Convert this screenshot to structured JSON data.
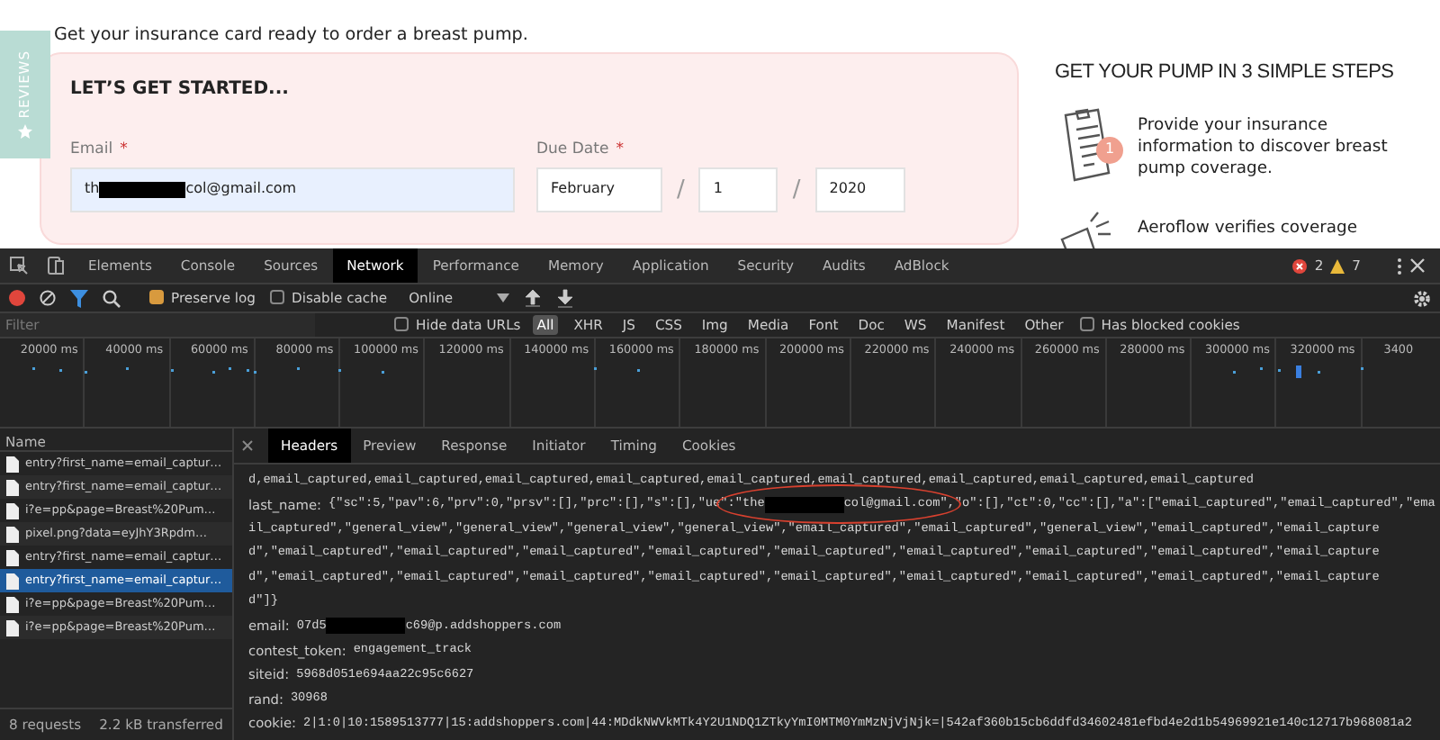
{
  "site": {
    "reviews_tab": "REVIEWS",
    "intro": "Get your insurance card ready to order a breast pump.",
    "form": {
      "title": "LET’S GET STARTED...",
      "email": {
        "label": "Email",
        "required_mark": "*",
        "segments": [
          {
            "kind": "text",
            "text": "th"
          },
          {
            "kind": "redaction"
          },
          {
            "kind": "text",
            "text": "col@gmail.com"
          }
        ]
      },
      "due_date": {
        "label": "Due Date",
        "required_mark": "*",
        "month": "February",
        "day": "1",
        "year": "2020",
        "separators": [
          "/",
          "/"
        ]
      }
    },
    "steps": {
      "title": "GET YOUR PUMP IN 3 SIMPLE STEPS",
      "items": [
        {
          "kind": "clipboard",
          "badge": "1",
          "text": "Provide your insurance information to discover breast pump coverage."
        },
        {
          "kind": "megaphone",
          "text": "Aeroflow verifies coverage"
        }
      ]
    }
  },
  "devtools": {
    "tabs": [
      {
        "label": "Elements",
        "selected": false
      },
      {
        "label": "Console",
        "selected": false
      },
      {
        "label": "Sources",
        "selected": false
      },
      {
        "label": "Network",
        "selected": true
      },
      {
        "label": "Performance",
        "selected": false
      },
      {
        "label": "Memory",
        "selected": false
      },
      {
        "label": "Application",
        "selected": false
      },
      {
        "label": "Security",
        "selected": false
      },
      {
        "label": "Audits",
        "selected": false
      },
      {
        "label": "AdBlock",
        "selected": false
      }
    ],
    "errors": "2",
    "warnings": "7",
    "toolbar": {
      "filter_active": true,
      "preserve_log": {
        "label": "Preserve log",
        "checked": true
      },
      "disable_cache": {
        "label": "Disable cache",
        "checked": false
      },
      "throttling": "Online"
    },
    "filter_bar": {
      "placeholder": "Filter",
      "hide_data_urls": {
        "label": "Hide data URLs",
        "checked": false
      },
      "types": [
        {
          "label": "All",
          "selected": true
        },
        {
          "label": "XHR",
          "selected": false
        },
        {
          "label": "JS",
          "selected": false
        },
        {
          "label": "CSS",
          "selected": false
        },
        {
          "label": "Img",
          "selected": false
        },
        {
          "label": "Media",
          "selected": false
        },
        {
          "label": "Font",
          "selected": false
        },
        {
          "label": "Doc",
          "selected": false
        },
        {
          "label": "WS",
          "selected": false
        },
        {
          "label": "Manifest",
          "selected": false
        },
        {
          "label": "Other",
          "selected": false
        }
      ],
      "has_blocked_cookies": {
        "label": "Has blocked cookies",
        "checked": false
      }
    },
    "timeline": {
      "ticks": [
        "20000 ms",
        "40000 ms",
        "60000 ms",
        "80000 ms",
        "100000 ms",
        "120000 ms",
        "140000 ms",
        "160000 ms",
        "180000 ms",
        "200000 ms",
        "220000 ms",
        "240000 ms",
        "260000 ms",
        "280000 ms",
        "300000 ms",
        "320000 ms",
        "3400"
      ]
    },
    "requests": {
      "header": "Name",
      "items": [
        {
          "name": "entry?first_name=email_captur…",
          "selected": false
        },
        {
          "name": "entry?first_name=email_captur…",
          "selected": false
        },
        {
          "name": "i?e=pp&page=Breast%20Pum…",
          "selected": false
        },
        {
          "name": "pixel.png?data=eyJhY3Rpdm…",
          "selected": false
        },
        {
          "name": "entry?first_name=email_captur…",
          "selected": false
        },
        {
          "name": "entry?first_name=email_captur…",
          "selected": true
        },
        {
          "name": "i?e=pp&page=Breast%20Pum…",
          "selected": false
        },
        {
          "name": "i?e=pp&page=Breast%20Pum…",
          "selected": false
        }
      ],
      "summary": [
        "8 requests",
        "2.2 kB transferred"
      ]
    },
    "details": {
      "tabs": [
        {
          "label": "Headers",
          "selected": true
        },
        {
          "label": "Preview",
          "selected": false
        },
        {
          "label": "Response",
          "selected": false
        },
        {
          "label": "Initiator",
          "selected": false
        },
        {
          "label": "Timing",
          "selected": false
        },
        {
          "label": "Cookies",
          "selected": false
        }
      ],
      "lines": [
        {
          "segments": [
            {
              "kind": "text",
              "text": "d,email_captured,email_captured,email_captured,email_captured,email_captured,email_captured,email_captured,email_captured,email_captured"
            }
          ]
        },
        {
          "key": "last_name:",
          "segments": [
            {
              "kind": "text",
              "text": "{\"sc\":5,\"pav\":6,\"prv\":0,\"prsv\":[],\"prc\":[],\"s\":[],\"ue\":"
            },
            {
              "kind": "circle",
              "segments": [
                {
                  "kind": "text",
                  "text": "\"the"
                },
                {
                  "kind": "redaction"
                },
                {
                  "kind": "text",
                  "text": "col@gmail.com\""
                }
              ]
            },
            {
              "kind": "text",
              "text": ",\"o\":[],\"ct\":0,\"cc\":[],\"a\":[\"email_captured\",\"email_captured\",\"ema"
            }
          ]
        },
        {
          "segments": [
            {
              "kind": "text",
              "text": "il_captured\",\"general_view\",\"general_view\",\"general_view\",\"general_view\",\"email_captured\",\"email_captured\",\"general_view\",\"email_captured\",\"email_capture"
            }
          ]
        },
        {
          "segments": [
            {
              "kind": "text",
              "text": "d\",\"email_captured\",\"email_captured\",\"email_captured\",\"email_captured\",\"email_captured\",\"email_captured\",\"email_captured\",\"email_captured\",\"email_capture"
            }
          ]
        },
        {
          "segments": [
            {
              "kind": "text",
              "text": "d\",\"email_captured\",\"email_captured\",\"email_captured\",\"email_captured\",\"email_captured\",\"email_captured\",\"email_captured\",\"email_captured\",\"email_capture"
            }
          ]
        },
        {
          "segments": [
            {
              "kind": "text",
              "text": "d\"]}"
            }
          ]
        },
        {
          "key": "email:",
          "segments": [
            {
              "kind": "text",
              "text": "07d5"
            },
            {
              "kind": "redaction"
            },
            {
              "kind": "text",
              "text": "c69@p.addshoppers.com"
            }
          ]
        },
        {
          "key": "contest_token:",
          "segments": [
            {
              "kind": "text",
              "text": "engagement_track"
            }
          ]
        },
        {
          "key": "siteid:",
          "segments": [
            {
              "kind": "text",
              "text": "5968d051e694aa22c95c6627"
            }
          ]
        },
        {
          "key": "rand:",
          "segments": [
            {
              "kind": "text",
              "text": "30968"
            }
          ]
        },
        {
          "key": "cookie:",
          "segments": [
            {
              "kind": "text",
              "text": "2|1:0|10:1589513777|15:addshoppers.com|44:MDdkNWVkMTk4Y2U1NDQ1ZTkyYmI0MTM0YmMzNjVjNjk=|542af360b15cb6ddfd34602481efbd4e2d1b54969921e140c12717b968081a2"
            }
          ]
        }
      ]
    }
  }
}
